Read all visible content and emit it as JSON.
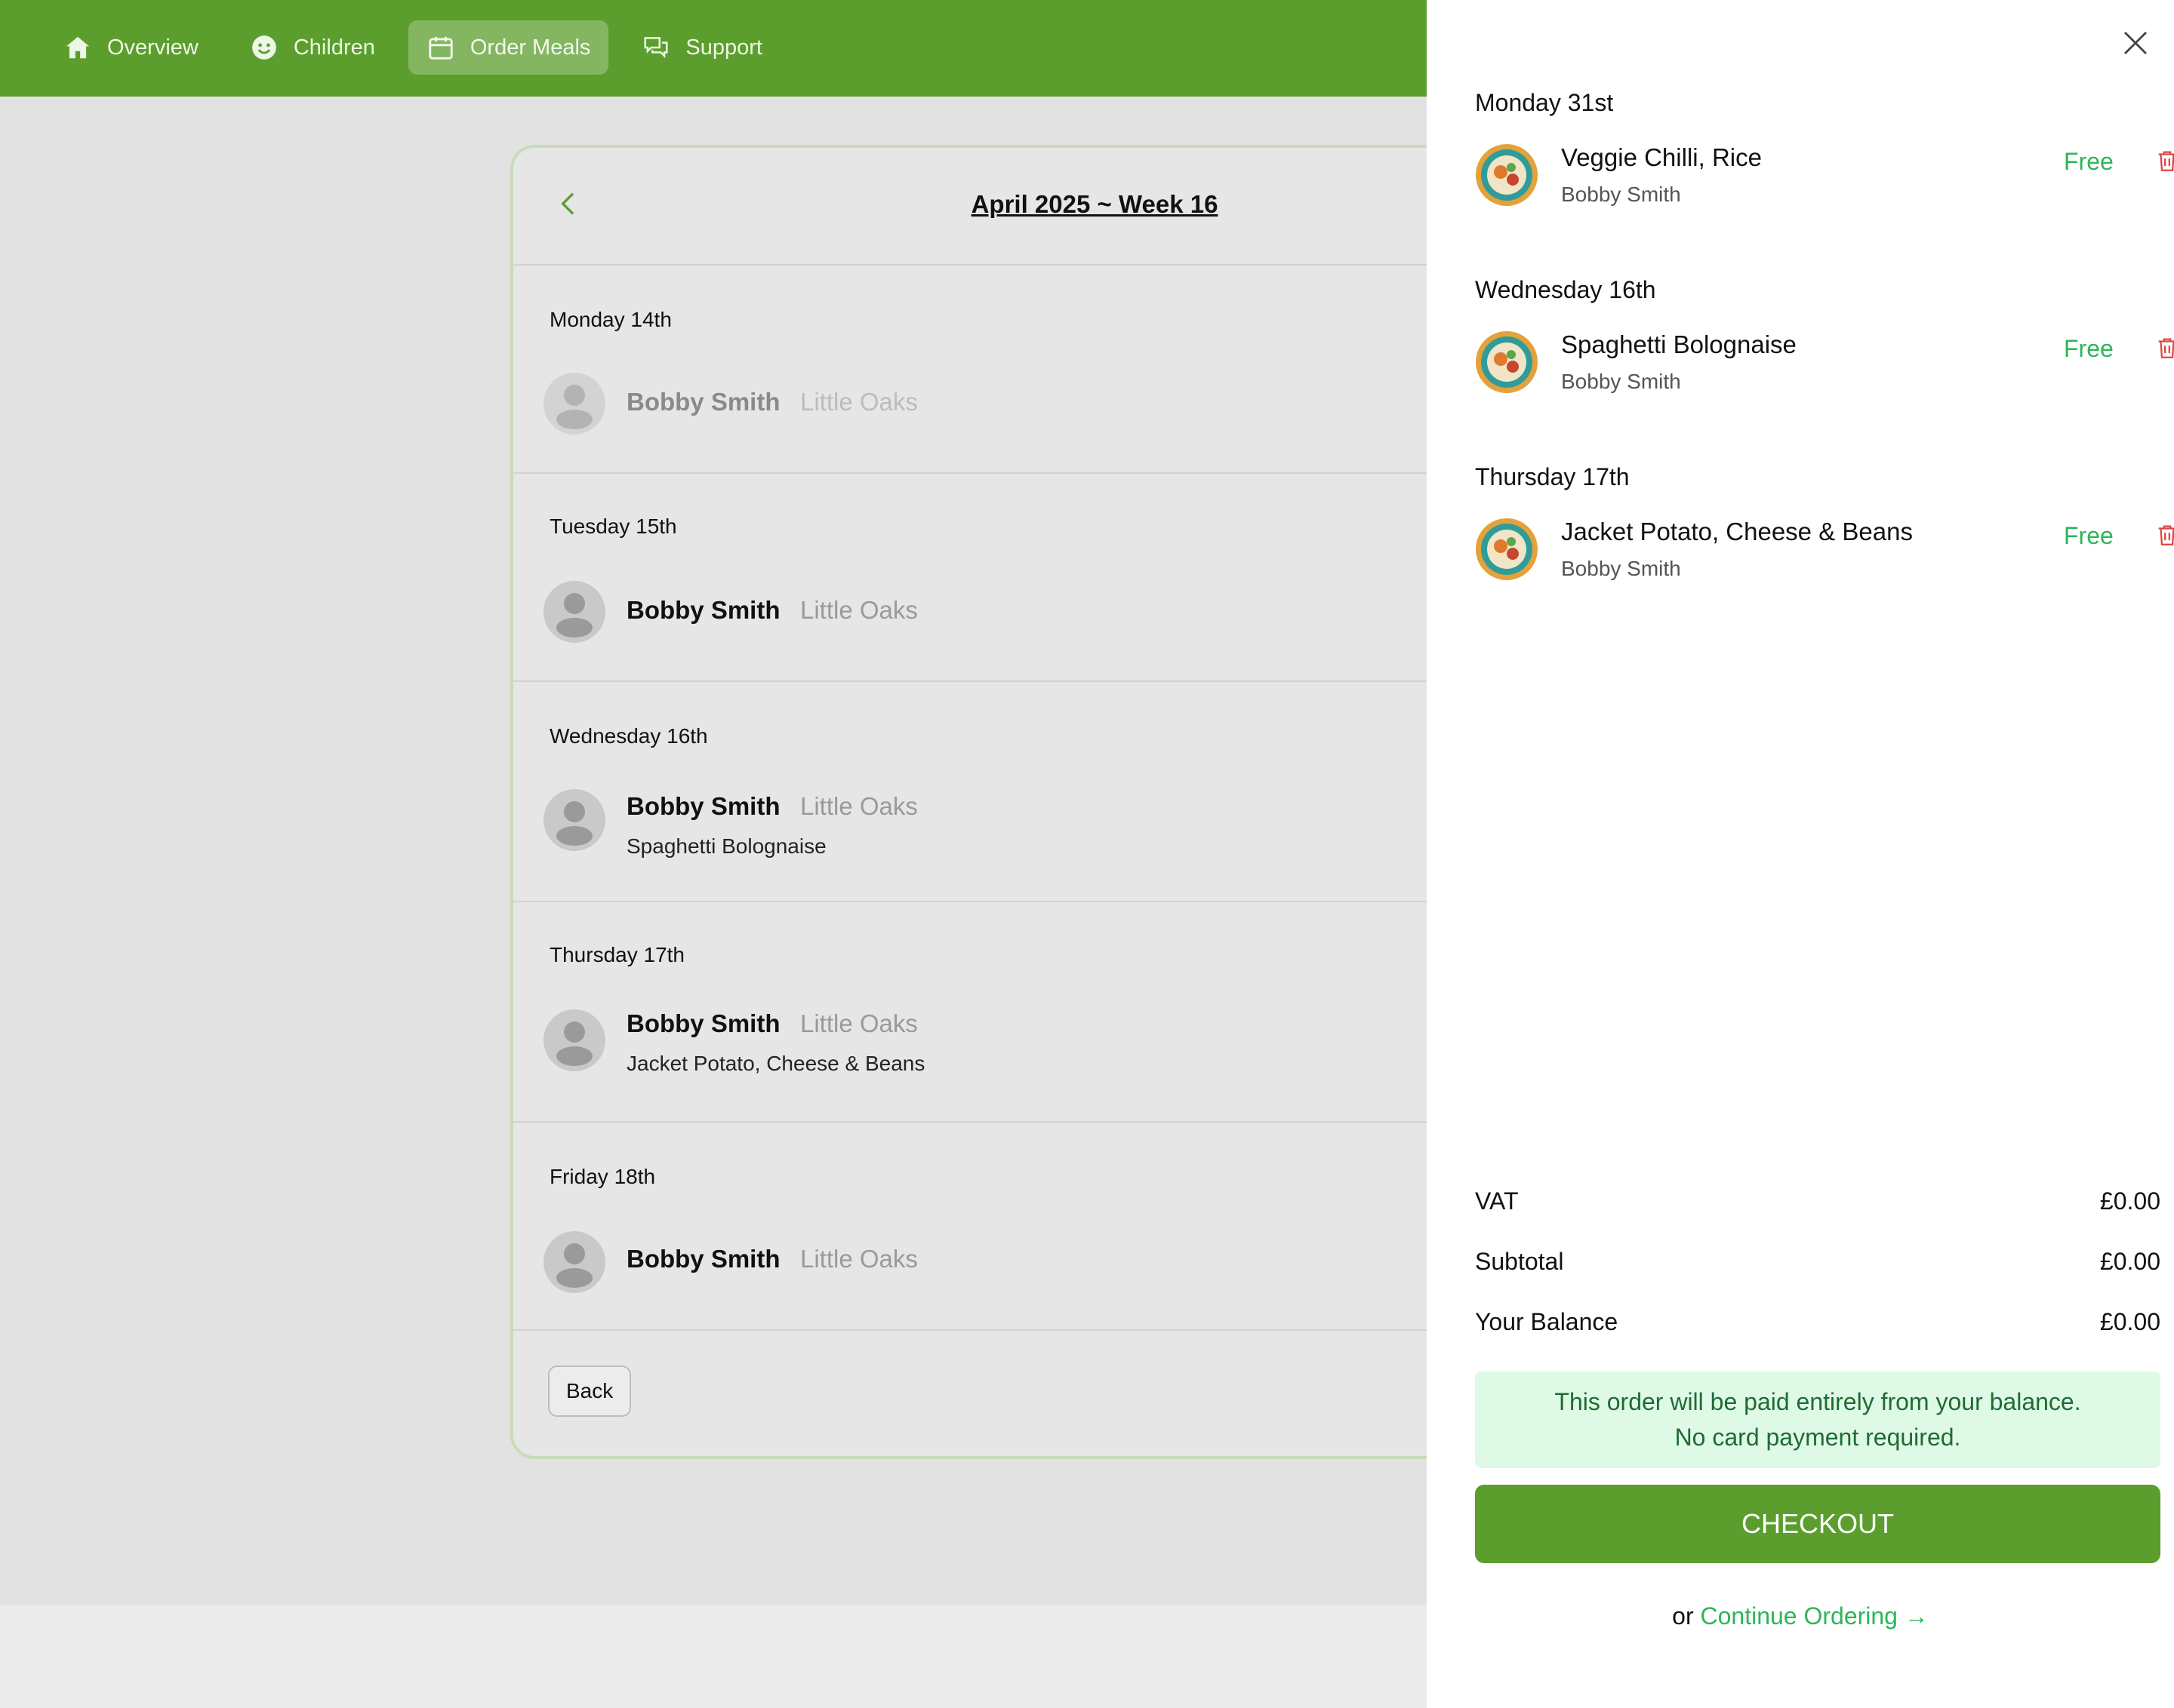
{
  "nav": {
    "items": [
      {
        "label": "Overview",
        "icon": "home-icon"
      },
      {
        "label": "Children",
        "icon": "smiley-icon"
      },
      {
        "label": "Order Meals",
        "icon": "calendar-icon",
        "active": true
      },
      {
        "label": "Support",
        "icon": "chat-icon"
      }
    ]
  },
  "week": {
    "title": "April 2025 ~ Week 16"
  },
  "days": [
    {
      "label": "Monday 14th",
      "child": "Bobby Smith",
      "school": "Little Oaks",
      "meal": ""
    },
    {
      "label": "Tuesday 15th",
      "child": "Bobby Smith",
      "school": "Little Oaks",
      "meal": ""
    },
    {
      "label": "Wednesday 16th",
      "child": "Bobby Smith",
      "school": "Little Oaks",
      "meal": "Spaghetti Bolognaise"
    },
    {
      "label": "Thursday 17th",
      "child": "Bobby Smith",
      "school": "Little Oaks",
      "meal": "Jacket Potato, Cheese & Beans"
    },
    {
      "label": "Friday 18th",
      "child": "Bobby Smith",
      "school": "Little Oaks",
      "meal": ""
    }
  ],
  "card": {
    "back_label": "Back"
  },
  "cart": {
    "items": [
      {
        "day": "Monday 31st",
        "meal": "Veggie Chilli, Rice",
        "child": "Bobby Smith",
        "price": "Free"
      },
      {
        "day": "Wednesday 16th",
        "meal": "Spaghetti Bolognaise",
        "child": "Bobby Smith",
        "price": "Free"
      },
      {
        "day": "Thursday 17th",
        "meal": "Jacket Potato, Cheese & Beans",
        "child": "Bobby Smith",
        "price": "Free"
      }
    ],
    "vat_label": "VAT",
    "vat_value": "£0.00",
    "subtotal_label": "Subtotal",
    "subtotal_value": "£0.00",
    "balance_label": "Your Balance",
    "balance_value": "£0.00",
    "notice_line1": "This order will be paid entirely from your balance.",
    "notice_line2": "No card payment required.",
    "checkout_label": "CHECKOUT",
    "or_label": "or",
    "continue_label": "Continue Ordering →"
  },
  "colors": {
    "brand_green": "#5b9e2d",
    "price_green": "#2eb55a",
    "trash_red": "#e04545",
    "notice_bg": "#def9e6"
  }
}
